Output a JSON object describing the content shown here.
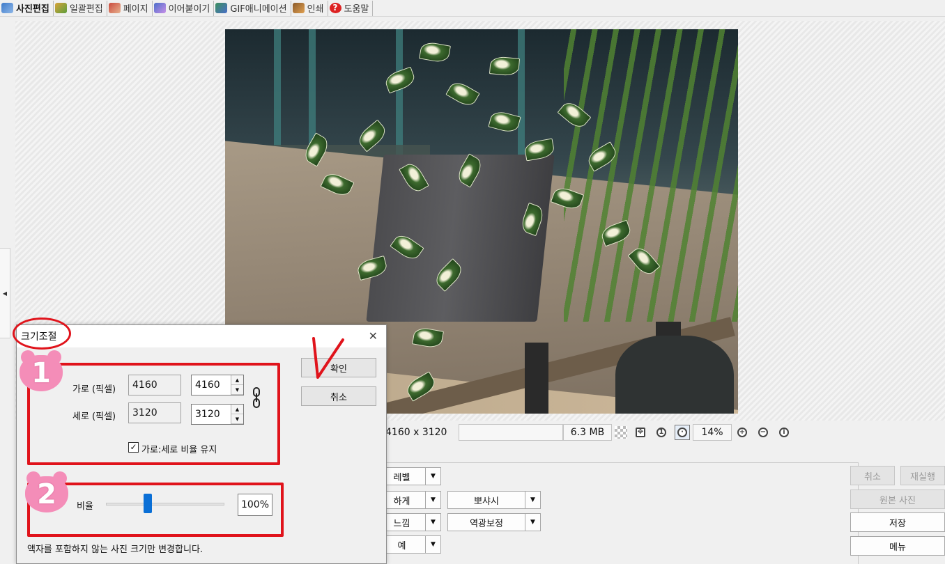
{
  "tabs": [
    {
      "label": "사진편집",
      "icon": "photo-edit-icon",
      "active": true
    },
    {
      "label": "일괄편집",
      "icon": "batch-edit-icon"
    },
    {
      "label": "페이지",
      "icon": "page-icon"
    },
    {
      "label": "이어붙이기",
      "icon": "join-icon"
    },
    {
      "label": "GIF애니메이션",
      "icon": "gif-animation-icon"
    },
    {
      "label": "인쇄",
      "icon": "print-icon"
    },
    {
      "label": "도움말",
      "icon": "help-icon"
    }
  ],
  "status": {
    "dimensions": "4160 x 3120",
    "blank": "",
    "filesize": "6.3 MB",
    "zoom": "14%"
  },
  "panel": {
    "dropdowns": [
      {
        "label": "레벨"
      },
      {
        "label": "하게"
      },
      {
        "label": "뽀샤시"
      },
      {
        "label": "느낌"
      },
      {
        "label": "역광보정"
      },
      {
        "label": "예"
      }
    ],
    "right_buttons": {
      "undo": "취소",
      "redo": "재실행",
      "original": "원본 사진",
      "save": "저장",
      "menu": "메뉴"
    }
  },
  "dialog": {
    "title": "크기조절",
    "ok": "확인",
    "cancel": "취소",
    "width_label": "가로 (픽셀)",
    "height_label": "세로 (픽셀)",
    "width_original": "4160",
    "width_value": "4160",
    "height_original": "3120",
    "height_value": "3120",
    "keep_ratio_label": "가로:세로 비율 유지",
    "keep_ratio_checked": true,
    "ratio_label": "비율",
    "ratio_value": "100%",
    "ratio_fraction": 0.35,
    "note": "액자를 포함하지 않는 사진 크기만 변경합니다."
  },
  "annotations": {
    "badge_1": "1",
    "badge_2": "2",
    "check_mark": "V",
    "color": "#e0131b"
  }
}
